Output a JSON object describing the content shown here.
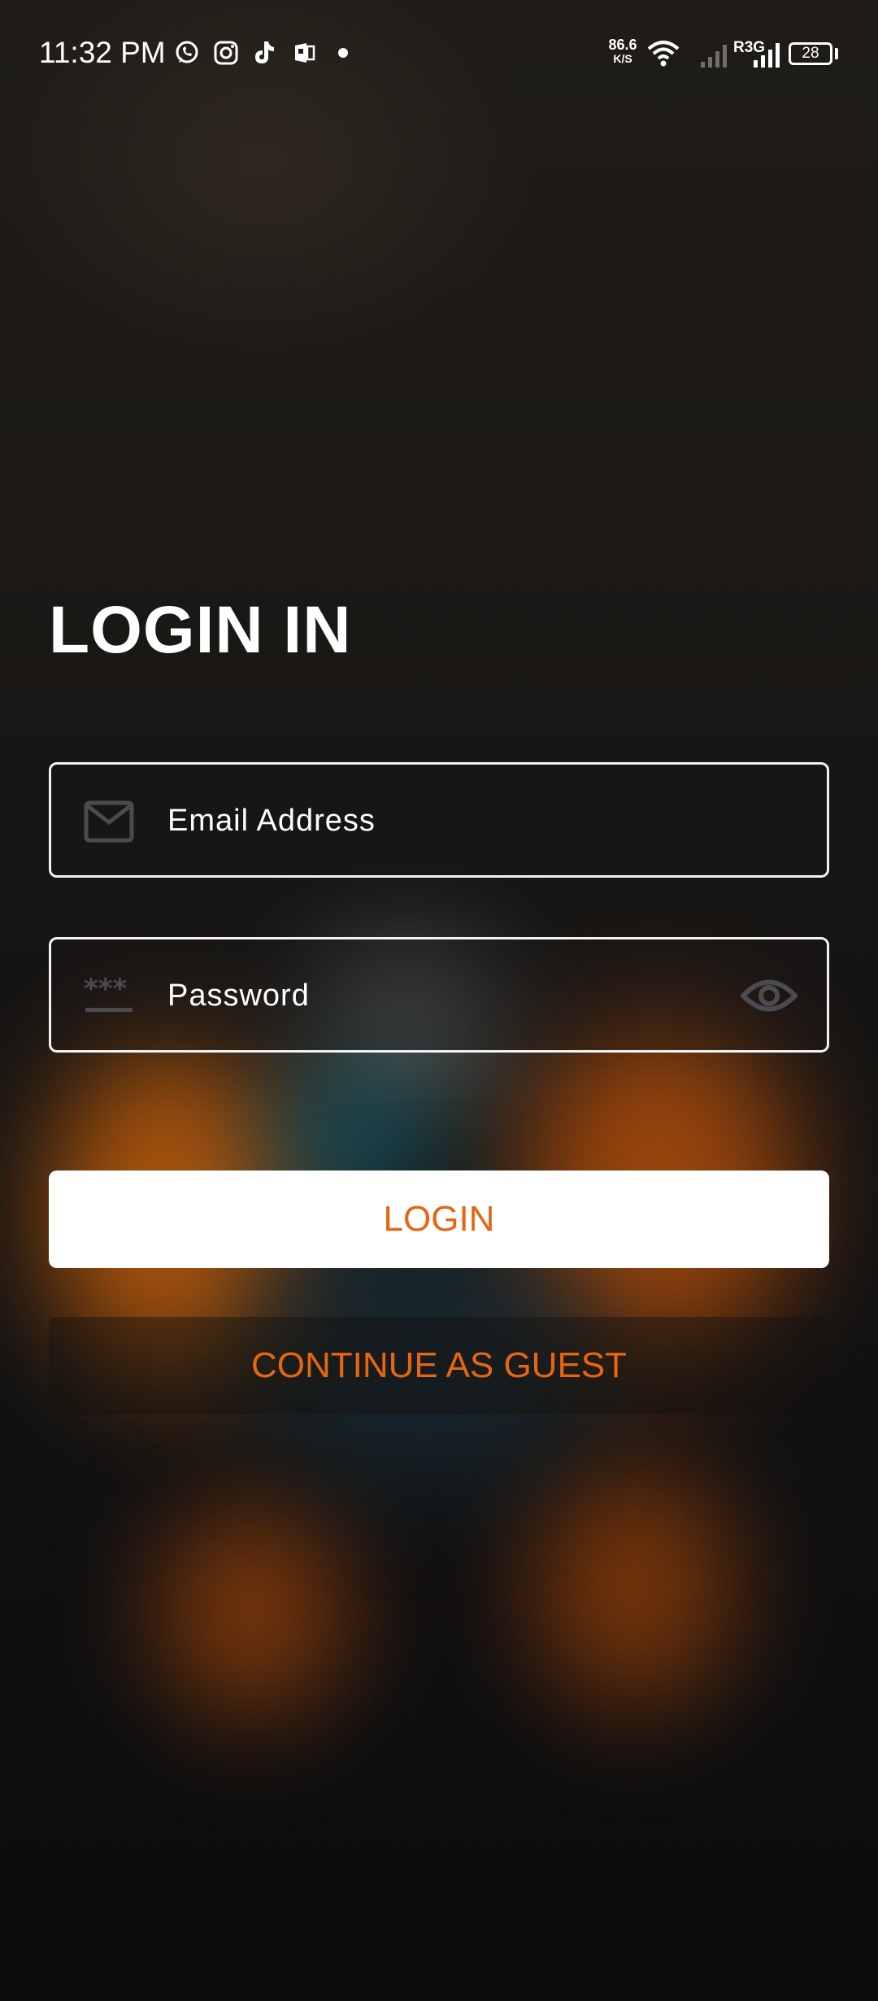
{
  "status_bar": {
    "time": "11:32 PM",
    "notification_icons": [
      "whatsapp-icon",
      "instagram-icon",
      "tiktok-icon",
      "app-icon",
      "dot-icon"
    ],
    "net_speed_value": "86.6",
    "net_speed_unit": "K/S",
    "network_label": "R3G",
    "battery_level": "28"
  },
  "login": {
    "title": "LOGIN IN",
    "email_field": {
      "placeholder": "Email Address",
      "icon": "mail-icon"
    },
    "password_field": {
      "placeholder": "Password",
      "icon": "password-icon",
      "toggle_icon": "eye-icon"
    },
    "login_button_label": "LOGIN",
    "guest_button_label": "CONTINUE AS GUEST"
  },
  "colors": {
    "accent": "#e8650f",
    "field_border": "#f2f2f2",
    "icon_muted": "#4a4b50",
    "button_bg": "#ffffff"
  }
}
